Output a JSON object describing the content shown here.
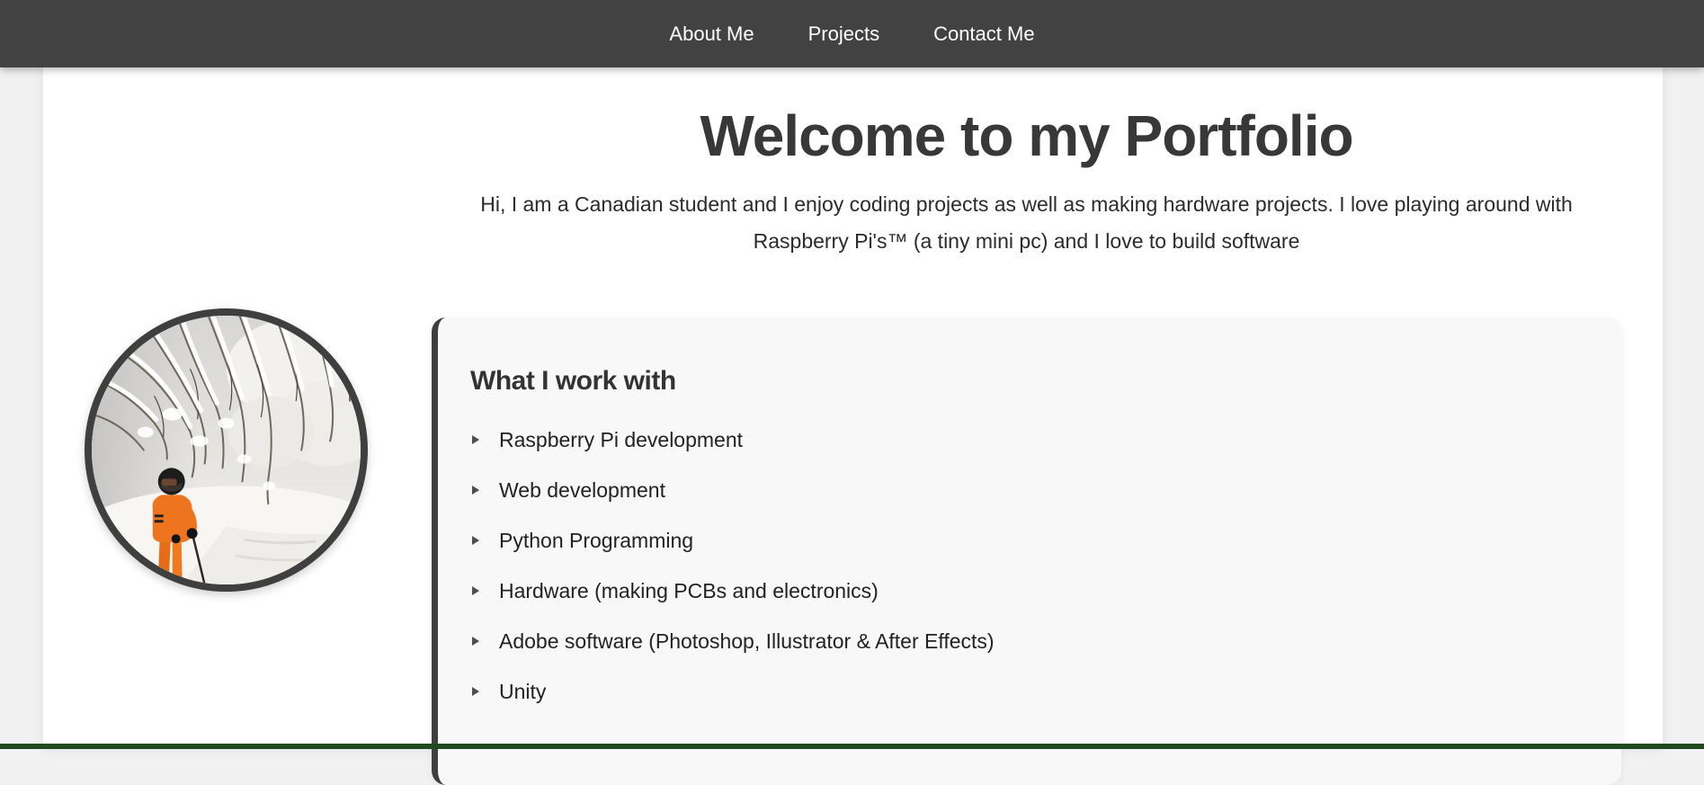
{
  "nav": {
    "links": [
      {
        "label": "About Me"
      },
      {
        "label": "Projects"
      },
      {
        "label": "Contact Me"
      }
    ]
  },
  "hero": {
    "title": "Welcome to my Portfolio",
    "intro": "Hi, I am a Canadian student and I enjoy coding projects as well as making hardware projects. I love playing around with Raspberry Pi's™ (a tiny mini pc) and I love to build software"
  },
  "profile_image": {
    "description": "circular photo of a skier in an orange suit under snow-covered branches"
  },
  "work_section": {
    "title": "What I work with",
    "items": [
      "Raspberry Pi development",
      "Web development",
      "Python Programming",
      "Hardware (making PCBs and electronics)",
      "Adobe software (Photoshop, Illustrator & After Effects)",
      "Unity"
    ]
  },
  "colors": {
    "navbar_bg": "#424242",
    "page_margin_bg": "#f1f1f1",
    "card_bg": "#f8f8f8",
    "accent_border": "#3f3f3f",
    "footer_bar": "#1d4a1e",
    "heading_text": "#383838",
    "body_text": "#2b2b2b",
    "skier_suit_orange": "#ee7420"
  }
}
